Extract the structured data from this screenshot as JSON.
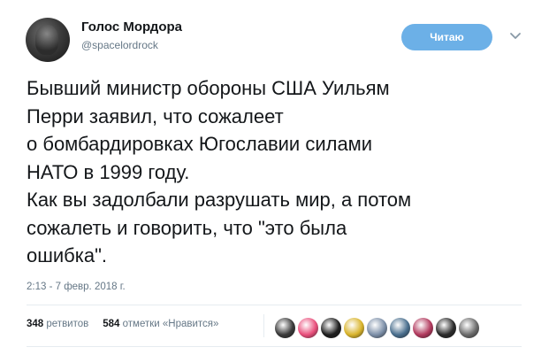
{
  "profile": {
    "name": "Голос Мордора",
    "handle": "@spacelordrock",
    "follow_label": "Читаю"
  },
  "tweet": {
    "lines": [
      "Бывший министр обороны США Уильям",
      "Перри заявил, что сожалеет",
      "о бомбардировках Югославии силами",
      "НАТО в 1999 году.",
      "Как вы задолбали разрушать мир, а потом",
      "сожалеть и говорить, что \"это была",
      "ошибка\"."
    ],
    "timestamp": "2:13 - 7 февр. 2018 г."
  },
  "stats": {
    "retweets_count": "348",
    "retweets_label": "ретвитов",
    "likes_count": "584",
    "likes_label": "отметки «Нравится»"
  },
  "likers": [
    {
      "name": "liker-1",
      "color": "#3a3a3a"
    },
    {
      "name": "liker-2",
      "color": "#e94f7c"
    },
    {
      "name": "liker-3",
      "color": "#1f1f1f"
    },
    {
      "name": "liker-4",
      "color": "#d9b42c"
    },
    {
      "name": "liker-5",
      "color": "#7c8fa8"
    },
    {
      "name": "liker-6",
      "color": "#4a6f8e"
    },
    {
      "name": "liker-7",
      "color": "#b23a5e"
    },
    {
      "name": "liker-8",
      "color": "#2b2b2b"
    },
    {
      "name": "liker-9",
      "color": "#6b6b6b"
    }
  ]
}
